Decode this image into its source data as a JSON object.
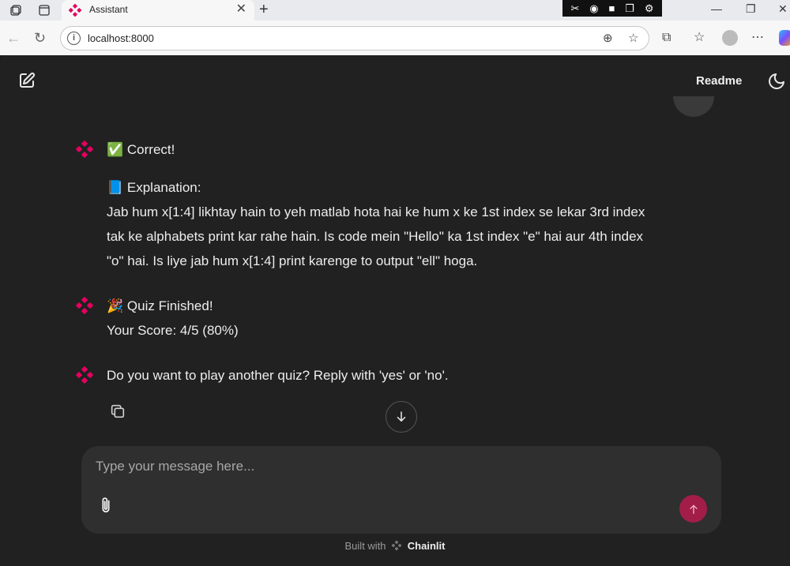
{
  "browser": {
    "tab_title": "Assistant",
    "url": "localhost:8000"
  },
  "header": {
    "readme_label": "Readme"
  },
  "messages": [
    {
      "lines": [
        "✅ Correct!"
      ],
      "paragraphs": [
        "📘 Explanation:",
        "Jab hum x[1:4] likhtay hain to yeh matlab hota hai ke hum x ke 1st index se lekar 3rd index",
        "tak ke alphabets print kar rahe hain. Is code mein \"Hello\" ka 1st index \"e\" hai aur 4th index",
        "\"o\" hai. Is liye jab hum x[1:4] print karenge to output \"ell\" hoga."
      ]
    },
    {
      "lines": [
        "🎉 Quiz Finished!",
        "Your Score: 4/5 (80%)"
      ]
    },
    {
      "lines": [
        "Do you want to play another quiz? Reply with 'yes' or 'no'."
      ]
    }
  ],
  "composer": {
    "placeholder": "Type your message here..."
  },
  "footer": {
    "built_with": "Built with",
    "brand": "Chainlit"
  },
  "colors": {
    "accent": "#e5005f",
    "send_button": "#a31d49",
    "background": "#212121"
  },
  "icons": [
    "new-chat-icon",
    "moon-icon",
    "copy-icon",
    "arrow-down-icon",
    "paperclip-icon",
    "arrow-up-icon",
    "chainlit-logo"
  ]
}
